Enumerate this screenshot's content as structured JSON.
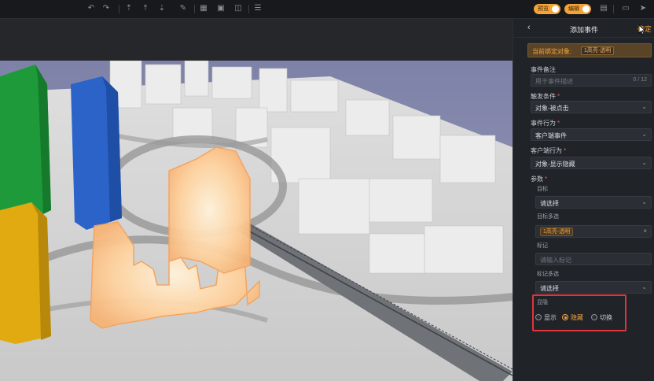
{
  "toolbar": {
    "icons": [
      "undo-icon",
      "redo-icon",
      "upload-icon",
      "align-top-icon",
      "download-icon",
      "brush-icon",
      "grid-icon",
      "image-icon",
      "layers-icon",
      "list-icon"
    ],
    "toggle_left_label": "预览",
    "toggle_right_label": "编辑",
    "right_icons": [
      "save-icon",
      "monitor-icon",
      "send-icon"
    ]
  },
  "panel": {
    "back_icon": "chevron-left-icon",
    "title": "添加事件",
    "confirm_label": "确定",
    "bound_object_label": "当前绑定对象:",
    "bound_object_value": "1高亮-透明",
    "event_note_label": "事件备注",
    "event_note_placeholder": "用于事件描述",
    "event_note_counter": "0 / 12",
    "trigger_label": "触发条件",
    "trigger_value": "对象-被点击",
    "behavior_label": "事件行为",
    "behavior_value": "客户端事件",
    "client_behavior_label": "客户端行为",
    "client_behavior_value": "对象-显示隐藏",
    "params_label": "参数",
    "target_label": "目标",
    "target_value": "请选择",
    "target_multi_label": "目标多选",
    "target_multi_tag": "1高亮-透明",
    "marker_label": "标记",
    "marker_placeholder": "请输入标记",
    "marker_multi_label": "标记多选",
    "marker_multi_value": "请选择",
    "visibility_label": "显隐",
    "visibility_options": [
      "显示",
      "隐藏",
      "切换"
    ],
    "visibility_selected": "隐藏"
  },
  "colors": {
    "accent": "#f2a33a",
    "highlight_box": "#e2343c",
    "panel_bg": "#202328",
    "field_bg": "#2b2f35"
  }
}
